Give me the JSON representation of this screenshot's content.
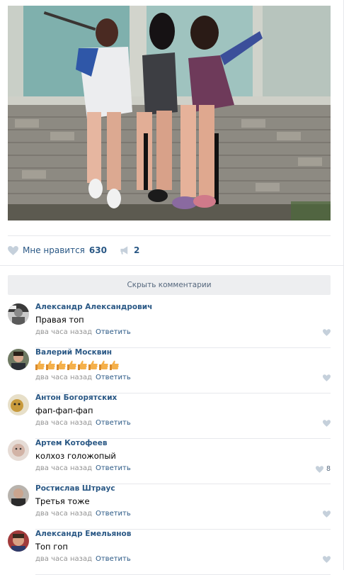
{
  "post": {
    "likes_label": "Мне нравится",
    "likes_count": "630",
    "shares_count": "2"
  },
  "comments_toggle": "Скрыть комментарии",
  "colors": {
    "link": "#2a5885",
    "muted": "#939393",
    "like_gray": "#c5d0db",
    "separator": "#e7e8ec"
  },
  "icons": {
    "like": "heart-icon",
    "share": "megaphone-icon"
  },
  "comments": [
    {
      "author": "Александр Александрович",
      "text": "Правая топ",
      "time": "два часа назад",
      "reply": "Ответить",
      "likes": ""
    },
    {
      "author": "Валерий Москвин",
      "text": "👍👍👍👍👍👍👍👍",
      "time": "два часа назад",
      "reply": "Ответить",
      "likes": ""
    },
    {
      "author": "Антон Богорятских",
      "text": "фап-фап-фап",
      "time": "два часа назад",
      "reply": "Ответить",
      "likes": ""
    },
    {
      "author": "Артем Котофеев",
      "text": "колхоз голожопый",
      "time": "два часа назад",
      "reply": "Ответить",
      "likes": "8"
    },
    {
      "author": "Ростислав Штраус",
      "text": "Третья тоже",
      "time": "два часа назад",
      "reply": "Ответить",
      "likes": ""
    },
    {
      "author": "Александр Емельянов",
      "text": "Топ гоп",
      "time": "два часа назад",
      "reply": "Ответить",
      "likes": ""
    }
  ]
}
